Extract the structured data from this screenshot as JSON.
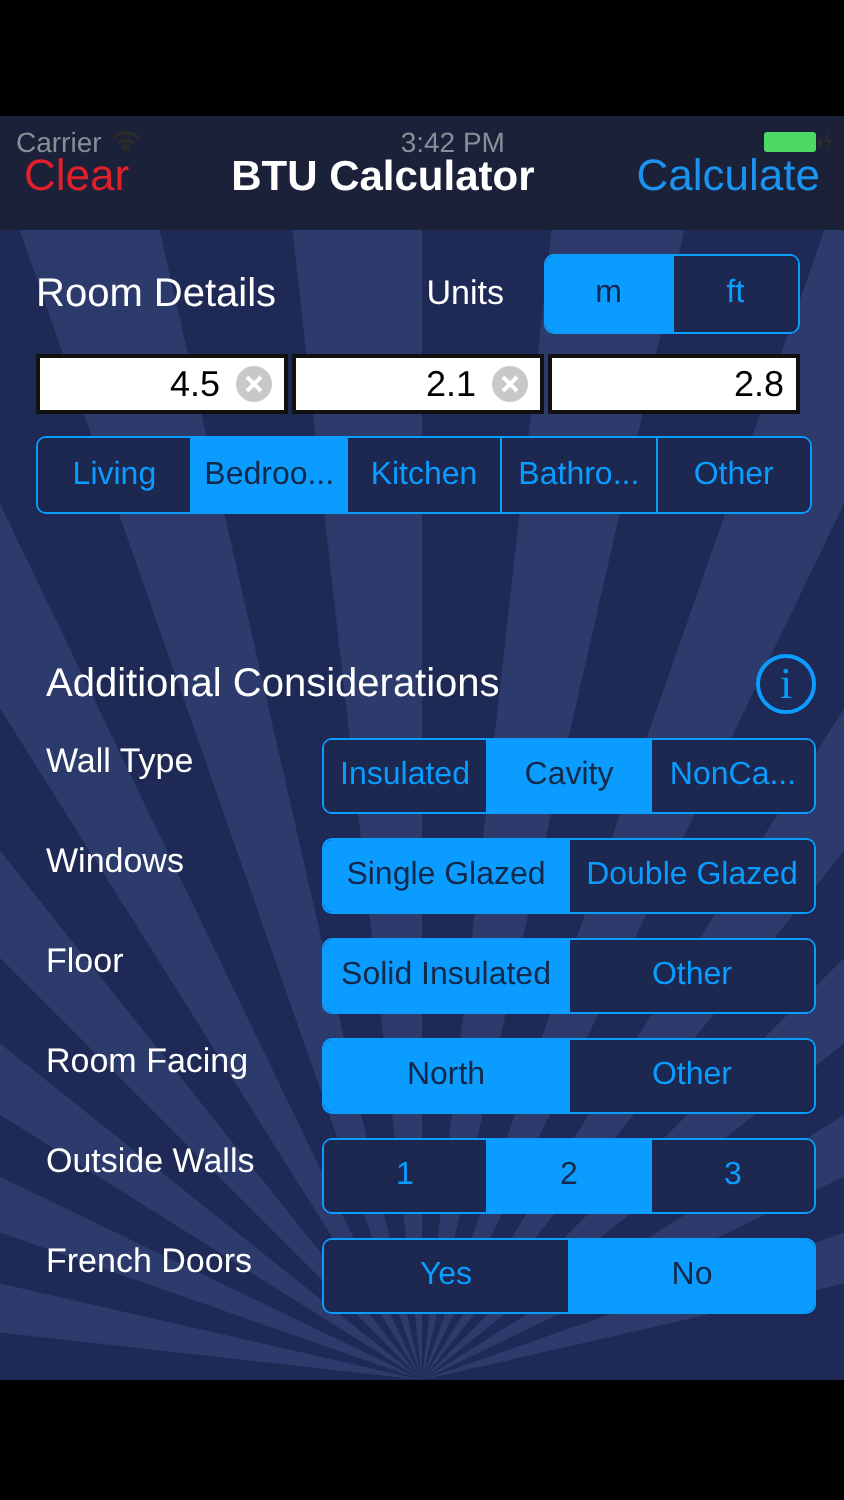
{
  "status_bar": {
    "carrier": "Carrier",
    "time": "3:42 PM"
  },
  "nav": {
    "left": "Clear",
    "title": "BTU Calculator",
    "right": "Calculate"
  },
  "room_details": {
    "title": "Room Details",
    "units_label": "Units",
    "units": [
      {
        "label": "m",
        "selected": true
      },
      {
        "label": "ft",
        "selected": false
      }
    ],
    "fields": [
      {
        "value": "4.5",
        "clearable": true
      },
      {
        "value": "2.1",
        "clearable": true
      },
      {
        "value": "2.8",
        "clearable": false
      }
    ],
    "room_types": [
      {
        "label": "Living",
        "selected": false
      },
      {
        "label": "Bedroo...",
        "selected": true
      },
      {
        "label": "Kitchen",
        "selected": false
      },
      {
        "label": "Bathro...",
        "selected": false
      },
      {
        "label": "Other",
        "selected": false
      }
    ]
  },
  "additional": {
    "title": "Additional Considerations",
    "info": "i",
    "rows": [
      {
        "label": "Wall Type",
        "options": [
          {
            "label": "Insulated",
            "selected": false
          },
          {
            "label": "Cavity",
            "selected": true
          },
          {
            "label": "NonCa...",
            "selected": false
          }
        ]
      },
      {
        "label": "Windows",
        "options": [
          {
            "label": "Single Glazed",
            "selected": true
          },
          {
            "label": "Double Glazed",
            "selected": false
          }
        ]
      },
      {
        "label": "Floor",
        "options": [
          {
            "label": "Solid Insulated",
            "selected": true
          },
          {
            "label": "Other",
            "selected": false
          }
        ]
      },
      {
        "label": "Room Facing",
        "options": [
          {
            "label": "North",
            "selected": true
          },
          {
            "label": "Other",
            "selected": false
          }
        ]
      },
      {
        "label": "Outside Walls",
        "options": [
          {
            "label": "1",
            "selected": false
          },
          {
            "label": "2",
            "selected": true
          },
          {
            "label": "3",
            "selected": false
          }
        ]
      },
      {
        "label": "French Doors",
        "options": [
          {
            "label": "Yes",
            "selected": false
          },
          {
            "label": "No",
            "selected": true
          }
        ]
      }
    ]
  }
}
